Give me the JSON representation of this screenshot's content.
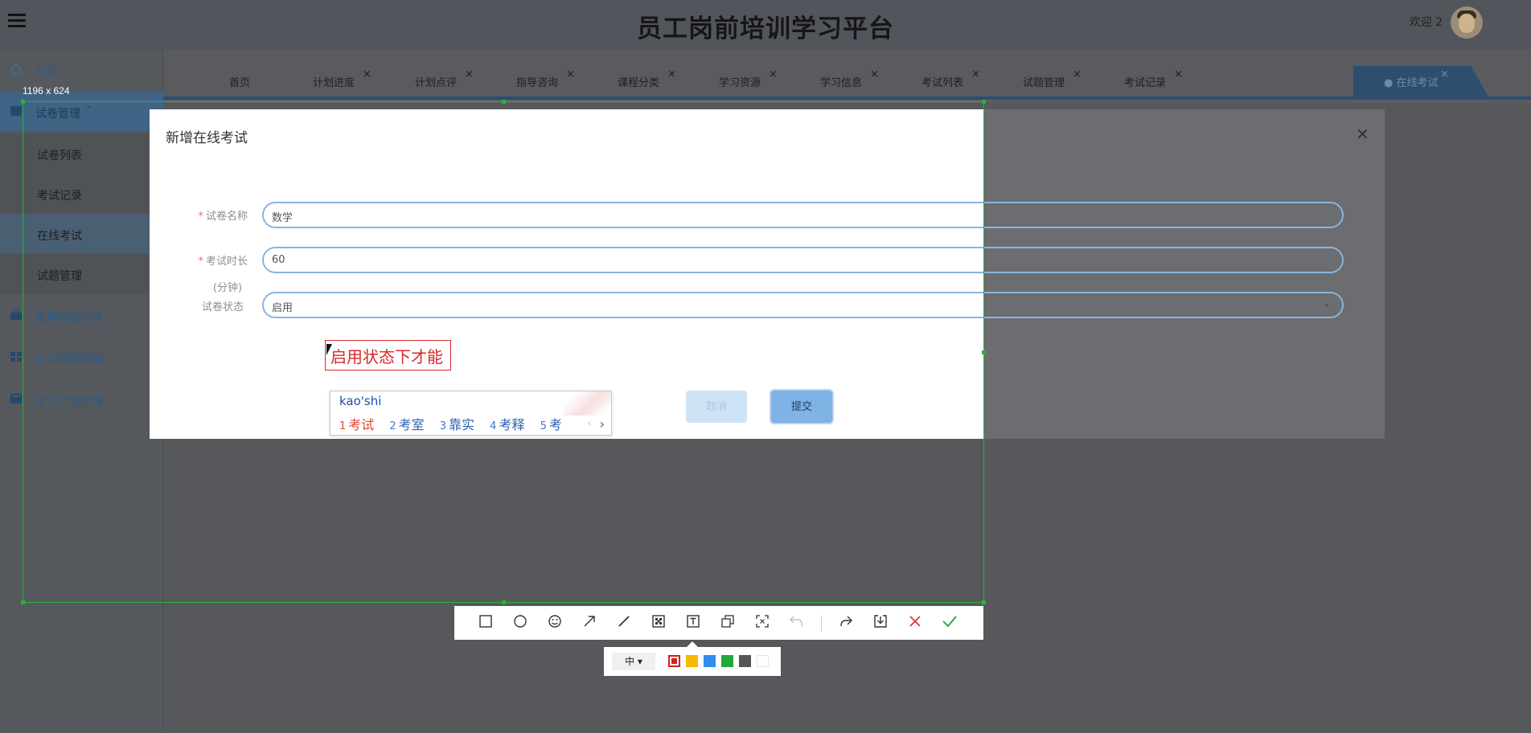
{
  "app": {
    "title": "员工岗前培训学习平台",
    "welcome": "欢迎 2"
  },
  "sidebar": {
    "items": [
      {
        "label": "首页",
        "icon": "home-icon"
      },
      {
        "label": "试卷管理",
        "icon": "paper-icon"
      },
      {
        "label": "指导咨询管理",
        "icon": "briefcase-icon"
      },
      {
        "label": "学习课程管理",
        "icon": "grid-icon"
      },
      {
        "label": "学习计划管理",
        "icon": "book-icon"
      }
    ],
    "subitems": [
      {
        "label": "试卷列表"
      },
      {
        "label": "考试记录"
      },
      {
        "label": "在线考试"
      },
      {
        "label": "试题管理"
      }
    ]
  },
  "tabs": [
    {
      "label": "首页"
    },
    {
      "label": "计划进度"
    },
    {
      "label": "计划点评"
    },
    {
      "label": "指导咨询"
    },
    {
      "label": "课程分类"
    },
    {
      "label": "学习资源"
    },
    {
      "label": "学习信息"
    },
    {
      "label": "考试列表"
    },
    {
      "label": "试题管理"
    },
    {
      "label": "考试记录"
    },
    {
      "label": "● 在线考试"
    }
  ],
  "dialog": {
    "title": "新增在线考试",
    "fields": [
      {
        "label": "试卷名称",
        "required": true,
        "value": "数学"
      },
      {
        "label": "考试时长",
        "sublabel": "(分钟)",
        "required": true,
        "value": "60"
      },
      {
        "label": "试卷状态",
        "required": false,
        "value": "启用"
      }
    ],
    "cancel_label": "取消",
    "submit_label": "提交"
  },
  "annotation": {
    "text": "启用状态下才能"
  },
  "ime": {
    "input": "kao'shi",
    "candidates": [
      {
        "n": "1",
        "w": "考试"
      },
      {
        "n": "2",
        "w": "考室"
      },
      {
        "n": "3",
        "w": "靠实"
      },
      {
        "n": "4",
        "w": "考释"
      },
      {
        "n": "5",
        "w": "考"
      }
    ],
    "prev": "‹",
    "next": "›"
  },
  "capture": {
    "size_label": "1196 x 624",
    "font_size_label": "中 ▾",
    "colors": [
      "#d0201f",
      "#f5b800",
      "#2f8ef0",
      "#23a93a",
      "#555555",
      "#ffffff"
    ]
  }
}
